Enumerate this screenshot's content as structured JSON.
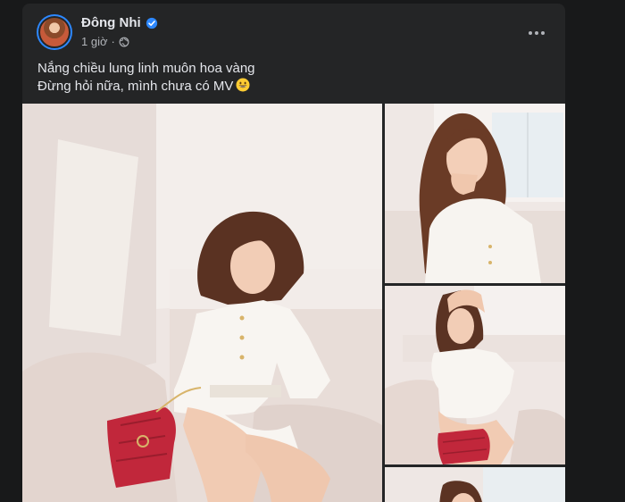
{
  "post": {
    "author": "Đông Nhi",
    "timestamp": "1 giờ",
    "separator": "·",
    "privacy_icon": "globe-icon",
    "verified_icon": "verified-badge-icon",
    "text_lines": [
      "Nắng chiều lung linh muôn hoa vàng",
      "Đừng hỏi nữa, mình chưa có MV"
    ],
    "emoji": "grinning-face-emoji",
    "menu_icon": "more-options-icon"
  },
  "colors": {
    "page_bg": "#18191a",
    "card_bg": "#242526",
    "primary_text": "#e4e6eb",
    "secondary_text": "#b0b3b8",
    "verified_blue": "#2d88ff"
  },
  "photos": [
    {
      "name": "woman-white-dress-sitting-on-sofa-photo"
    },
    {
      "name": "woman-posing-by-window-photo"
    },
    {
      "name": "woman-arm-raised-on-sofa-photo"
    },
    {
      "name": "woman-partial-photo"
    }
  ]
}
